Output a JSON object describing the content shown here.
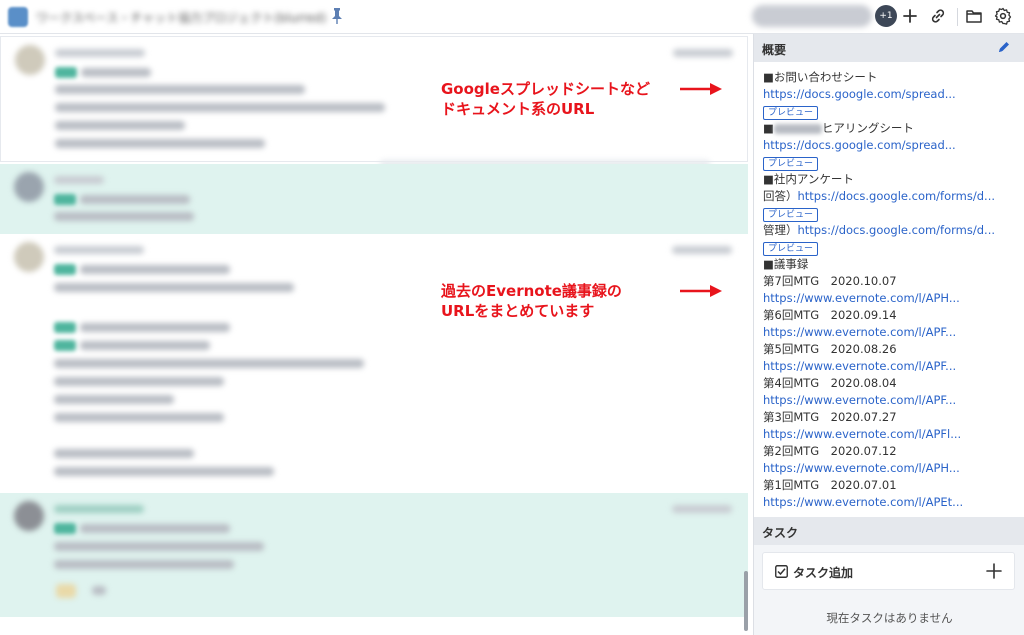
{
  "header": {
    "room_title": "ワークスペース・チャット協力プロジェクト(blurred)",
    "member_extra": "+1"
  },
  "annotations": {
    "top_line1": "Googleスプレッドシートなど",
    "top_line2": "ドキュメント系のURL",
    "bottom_line1": "過去のEvernote議事録の",
    "bottom_line2": "URLをまとめています"
  },
  "sidebar": {
    "overview_title": "概要",
    "preview_label": "プレビュー",
    "overview_rows": [
      {
        "type": "text",
        "text": "■お問い合わせシート"
      },
      {
        "type": "link",
        "text": "https://docs.google.com/spread..."
      },
      {
        "type": "preview"
      },
      {
        "type": "blurtext",
        "prefix": "■",
        "text": "ヒアリングシート"
      },
      {
        "type": "link",
        "text": "https://docs.google.com/spread..."
      },
      {
        "type": "preview"
      },
      {
        "type": "text",
        "text": "■社内アンケート"
      },
      {
        "type": "mixed",
        "prefix": "回答）",
        "text": "https://docs.google.com/forms/d..."
      },
      {
        "type": "preview"
      },
      {
        "type": "mixed",
        "prefix": "管理）",
        "text": "https://docs.google.com/forms/d..."
      },
      {
        "type": "preview"
      },
      {
        "type": "text",
        "text": "■議事録"
      },
      {
        "type": "text",
        "text": "第7回MTG　2020.10.07"
      },
      {
        "type": "link",
        "text": "https://www.evernote.com/l/APH..."
      },
      {
        "type": "text",
        "text": "第6回MTG　2020.09.14"
      },
      {
        "type": "link",
        "text": "https://www.evernote.com/l/APF..."
      },
      {
        "type": "text",
        "text": "第5回MTG　2020.08.26"
      },
      {
        "type": "link",
        "text": "https://www.evernote.com/l/APF..."
      },
      {
        "type": "text",
        "text": "第4回MTG　2020.08.04"
      },
      {
        "type": "link",
        "text": "https://www.evernote.com/l/APF..."
      },
      {
        "type": "text",
        "text": "第3回MTG　2020.07.27"
      },
      {
        "type": "link",
        "text": "https://www.evernote.com/l/APFl..."
      },
      {
        "type": "text",
        "text": "第2回MTG　2020.07.12"
      },
      {
        "type": "link",
        "text": "https://www.evernote.com/l/APH..."
      },
      {
        "type": "text",
        "text": "第1回MTG　2020.07.01"
      },
      {
        "type": "link",
        "text": "https://www.evernote.com/l/APEt..."
      }
    ],
    "task_title": "タスク",
    "task_add_label": "タスク追加",
    "no_task_text": "現在タスクはありません"
  },
  "colors": {
    "annotation_red": "#e8141c",
    "link_blue": "#2a63c9",
    "highlight_green": "#dff3ef"
  }
}
